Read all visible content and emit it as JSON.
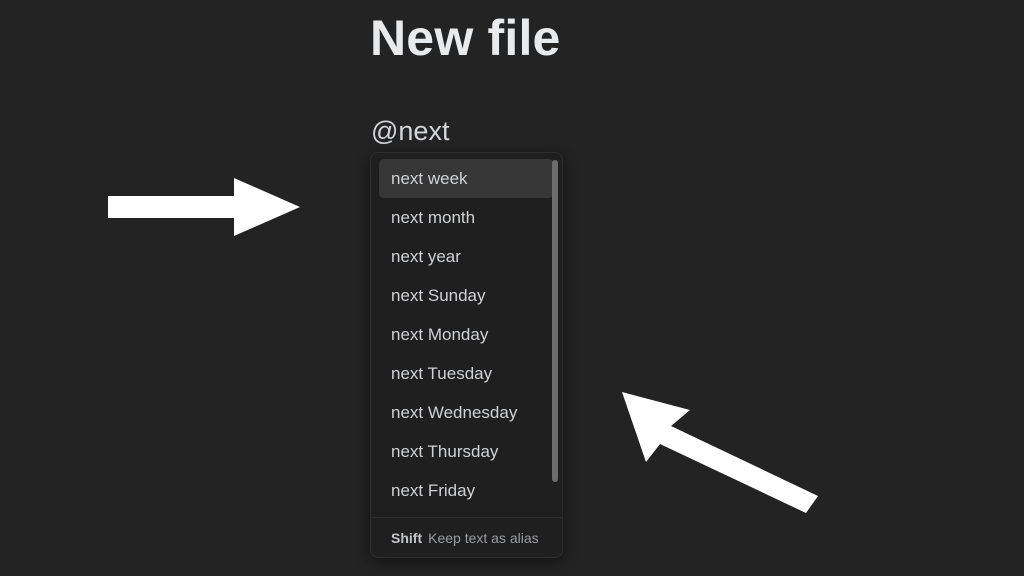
{
  "theme": {
    "page_background": "#232323",
    "popup_background": "#1f1f1f",
    "popup_border": "#2e2e2e",
    "selected_item_background": "#363636",
    "primary_text": "#e9eaec",
    "item_text": "#cfd1d4",
    "muted_text": "#9a9c9f",
    "scrollbar_thumb": "#6d6d6d",
    "annotation_arrow": "#ffffff"
  },
  "note": {
    "title": "New file",
    "editor_text": "@next"
  },
  "suggestion_popup": {
    "items": [
      {
        "label": "next week",
        "selected": true
      },
      {
        "label": "next month",
        "selected": false
      },
      {
        "label": "next year",
        "selected": false
      },
      {
        "label": "next Sunday",
        "selected": false
      },
      {
        "label": "next Monday",
        "selected": false
      },
      {
        "label": "next Tuesday",
        "selected": false
      },
      {
        "label": "next Wednesday",
        "selected": false
      },
      {
        "label": "next Thursday",
        "selected": false
      },
      {
        "label": "next Friday",
        "selected": false
      }
    ],
    "footer": {
      "key": "Shift",
      "description": "Keep text as alias"
    },
    "scrollbar": {
      "visible": true
    }
  },
  "annotations": [
    {
      "name": "arrow-pointing-right-at-selected-item",
      "direction": "right"
    },
    {
      "name": "arrow-pointing-up-left-at-suggestion-list",
      "direction": "up-left"
    }
  ]
}
